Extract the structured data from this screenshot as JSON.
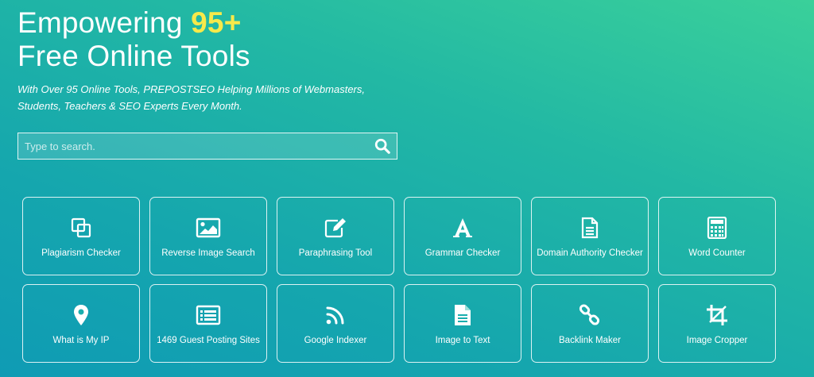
{
  "hero": {
    "title_line1": "Empowering",
    "title_accent": "95+",
    "title_line2": "Free Online Tools",
    "subtitle": "With Over 95 Online Tools, PREPOSTSEO Helping Millions of Webmasters, Students, Teachers & SEO Experts Every Month."
  },
  "search": {
    "placeholder": "Type to search.",
    "icon": "search-icon"
  },
  "colors": {
    "accent": "#f7e94a",
    "gradient_start": "#3ad09a",
    "gradient_end": "#0f9bb4"
  },
  "tools": [
    {
      "label": "Plagiarism Checker",
      "icon": "copy-icon"
    },
    {
      "label": "Reverse Image Search",
      "icon": "image-icon"
    },
    {
      "label": "Paraphrasing Tool",
      "icon": "edit-icon"
    },
    {
      "label": "Grammar Checker",
      "icon": "font-icon"
    },
    {
      "label": "Domain Authority Checker",
      "icon": "document-icon"
    },
    {
      "label": "Word Counter",
      "icon": "calculator-icon"
    },
    {
      "label": "What is My IP",
      "icon": "map-marker-icon"
    },
    {
      "label": "1469 Guest Posting Sites",
      "icon": "list-icon"
    },
    {
      "label": "Google Indexer",
      "icon": "rss-icon"
    },
    {
      "label": "Image to Text",
      "icon": "file-text-icon"
    },
    {
      "label": "Backlink Maker",
      "icon": "link-icon"
    },
    {
      "label": "Image Cropper",
      "icon": "crop-icon"
    }
  ]
}
